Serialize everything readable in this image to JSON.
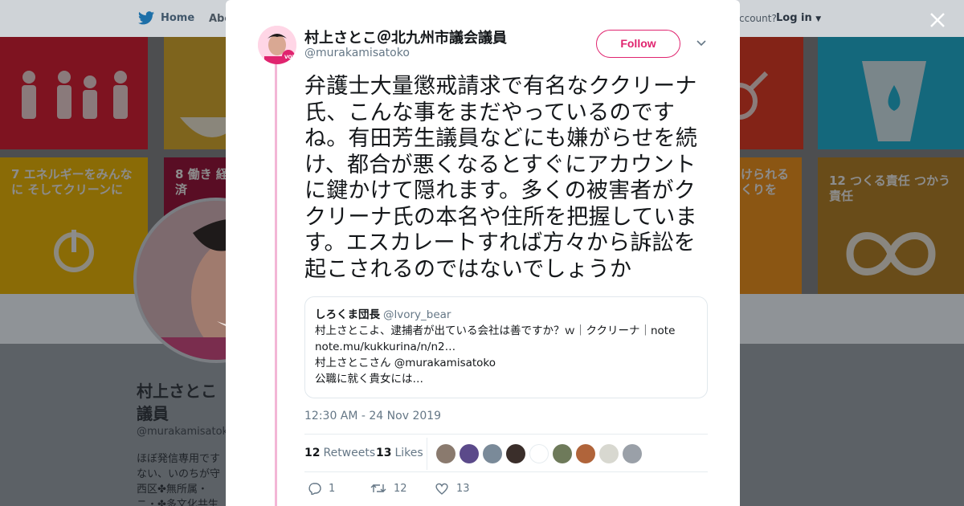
{
  "background": {
    "nav": {
      "home": "Home",
      "about": "Abo",
      "account_prompt": "ccount?",
      "login": "Log in"
    },
    "banner_tiles": [
      {
        "text": "",
        "color": "#e5243b"
      },
      {
        "text": "",
        "color": "#e5b735"
      },
      {
        "text": "",
        "color": "#4c9f38"
      },
      {
        "text": "",
        "color": "#26bde2"
      },
      {
        "text": "7 エネルギーをみんなに そしてクリーンに",
        "color": "#fcc30b"
      },
      {
        "text": "8 働き 経済",
        "color": "#a21942"
      },
      {
        "text": "けられる くりを",
        "color": "#fd9d24"
      },
      {
        "text": "12 つくる責任 つかう責任",
        "color": "#bf8b2e"
      }
    ],
    "profile_name": "村上さとこ 議員",
    "profile_handle": "@murakamisatok",
    "bio": "ほぼ発信専用です ない、いのちが守 西区✤無所属・ ニ・✤多文化共生"
  },
  "tweet": {
    "author_name": "村上さとこ＠北九州市議会議員",
    "author_handle": "@murakamisatoko",
    "follow_label": "Follow",
    "text": "弁護士大量懲戒請求で有名なククリーナ氏、こんな事をまだやっているのですね。有田芳生議員などにも嫌がらせを続け、都合が悪くなるとすぐにアカウントに鍵かけて隠れます。多くの被害者がククリーナ氏の本名や住所を把握しています。エスカレートすれば方々から訴訟を起こされるのではないでしょうか",
    "quote": {
      "name": "しろくま団長",
      "handle": "@lvory_bear",
      "line1": "村上さとこよ、逮捕者が出ている会社は善ですか？ｗ｜ククリーナ｜note",
      "line2": "note.mu/kukkurina/n/n2…",
      "line3": "村上さとこさん @murakamisatoko",
      "line4": "公職に就く貴女には…"
    },
    "timestamp": "12:30 AM - 24 Nov 2019",
    "retweets_count": "12",
    "retweets_label": "Retweets",
    "likes_count": "13",
    "likes_label": "Likes",
    "liker_colors": [
      "#8a7a6e",
      "#5b4a8a",
      "#7a8a99",
      "#3a2e2a",
      "#ffffff",
      "#6e7a5a",
      "#b0643a",
      "#d8d8d0",
      "#9aa0a8"
    ],
    "reply_count": "1",
    "retweet_count": "12",
    "like_count": "13",
    "accent_color": "#e0246f"
  }
}
